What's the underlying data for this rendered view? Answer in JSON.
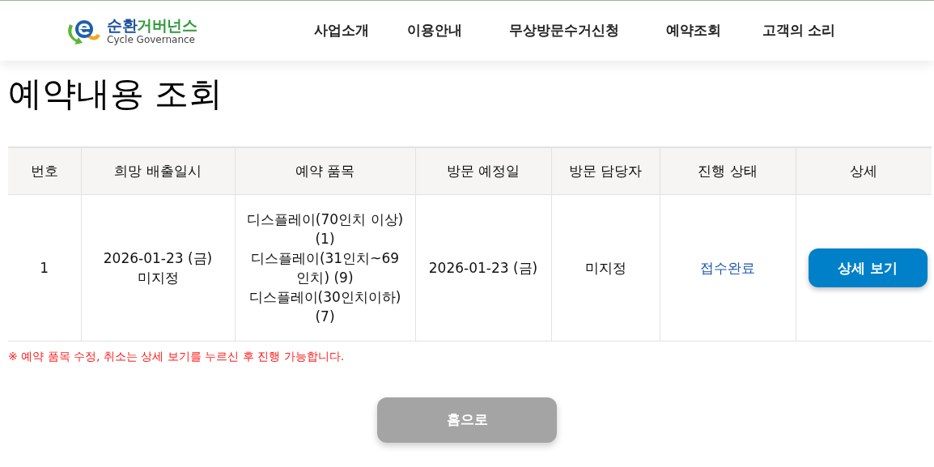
{
  "logo": {
    "title_parts": [
      {
        "text": "순환",
        "color": "#1b4f9c"
      },
      {
        "text": "거버넌스",
        "color": "#2f9a3a"
      }
    ],
    "subtitle": "Cycle Governance"
  },
  "nav": [
    "사업소개",
    "이용안내",
    "무상방문수거신청",
    "예약조회",
    "고객의 소리"
  ],
  "page_title": "예약내용 조회",
  "table": {
    "columns": [
      "번호",
      "희망 배출일시",
      "예약 품목",
      "방문 예정일",
      "방문 담당자",
      "진행 상태",
      "상세"
    ],
    "rows": [
      {
        "number": "1",
        "desired_date": [
          "2026-01-23 (금)",
          "미지정"
        ],
        "items": [
          "디스플레이(70인치 이상)(1)",
          "디스플레이(31인치~69인치) (9)",
          "디스플레이(30인치이하)(7)"
        ],
        "visit_date": "2026-01-23 (금)",
        "staff": "미지정",
        "status": "접수완료",
        "detail_button": "상세 보기"
      }
    ]
  },
  "notice": "※ 예약 품목 수정, 취소는 상세 보기를 누르신 후 진행 가능합니다.",
  "home_button": "홈으로"
}
